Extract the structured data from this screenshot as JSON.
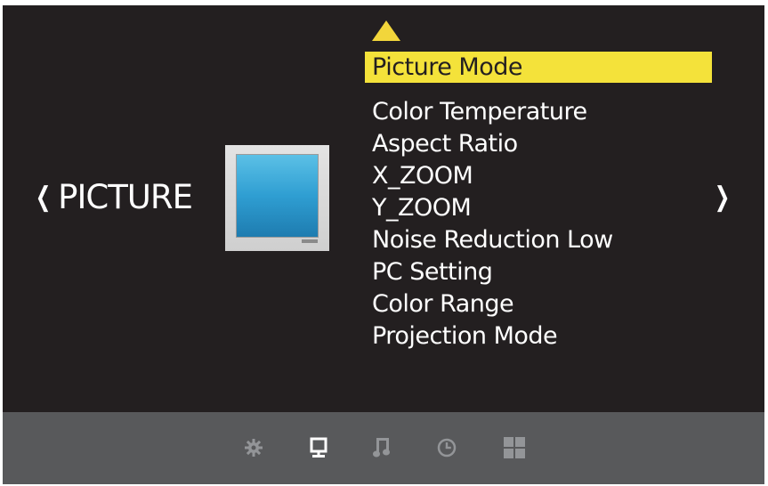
{
  "category": {
    "title": "PICTURE",
    "left_chevron": "❮",
    "right_chevron": "❯",
    "thumbnail_icon": "tv-picture-icon"
  },
  "menu": {
    "scroll_indicator_icon": "scroll-up-arrow-icon",
    "selected": "Picture Mode",
    "items": [
      "Color Temperature",
      "Aspect Ratio",
      "X_ZOOM",
      "Y_ZOOM",
      "Noise Reduction Low",
      "PC Setting",
      "Color Range",
      "Projection Mode"
    ]
  },
  "bottom_tabs": [
    {
      "icon": "settings-gear-icon",
      "active": false
    },
    {
      "icon": "picture-monitor-icon",
      "active": true
    },
    {
      "icon": "sound-note-icon",
      "active": false
    },
    {
      "icon": "time-clock-icon",
      "active": false
    },
    {
      "icon": "lock-grid-icon",
      "active": false
    }
  ],
  "colors": {
    "background": "#231f20",
    "highlight": "#f4e23a",
    "arrow": "#f2d63b",
    "bottom_bar": "#58595b",
    "inactive_icon": "#939598",
    "active_icon": "#ffffff"
  }
}
